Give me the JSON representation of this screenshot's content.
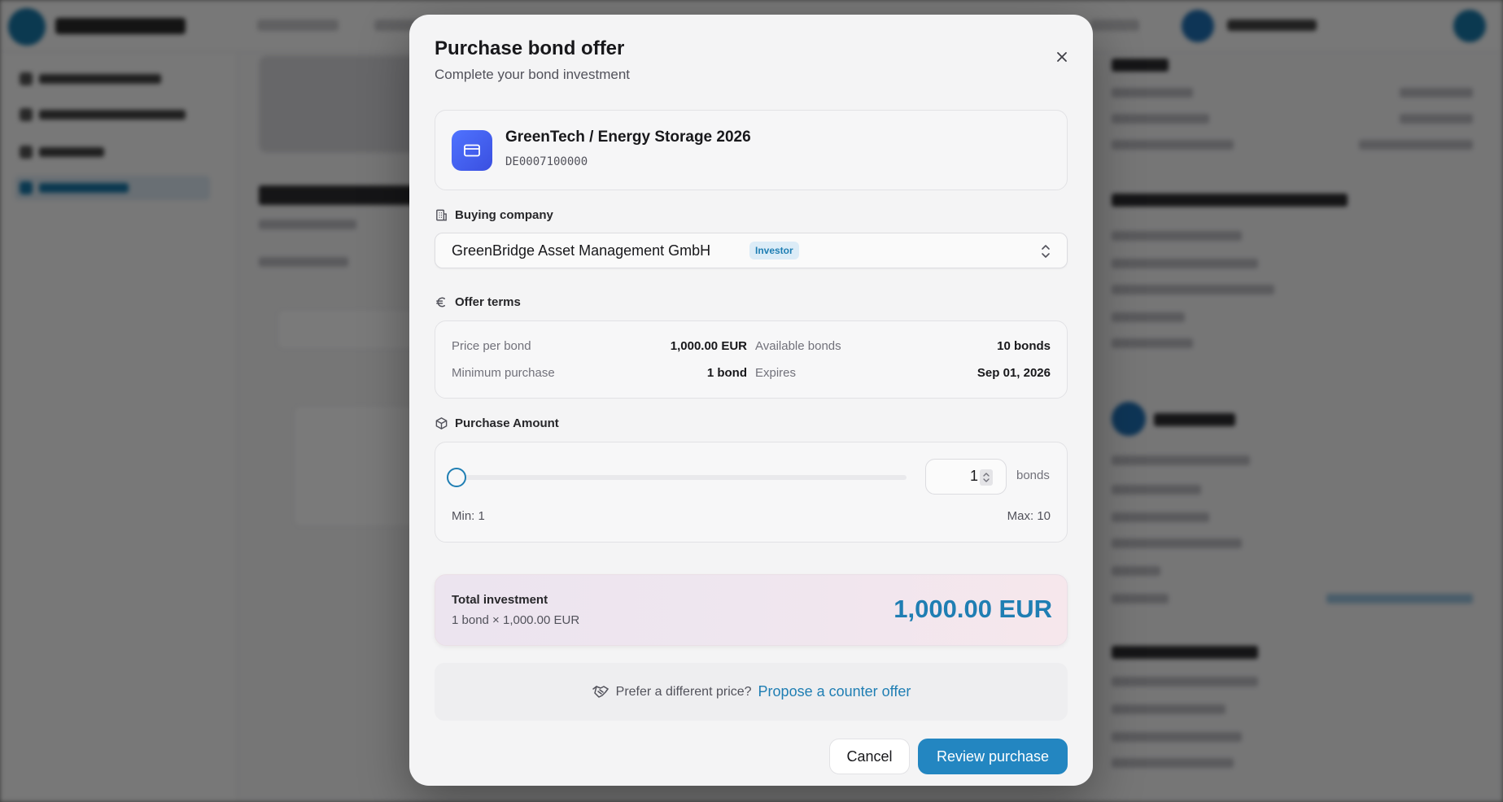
{
  "modal": {
    "title": "Purchase bond offer",
    "subtitle": "Complete your bond investment"
  },
  "bond": {
    "name": "GreenTech / Energy Storage 2026",
    "isin": "DE0007100000"
  },
  "buying_company": {
    "label": "Buying company",
    "selected": "GreenBridge Asset Management GmbH",
    "badge": "Investor"
  },
  "offer_terms": {
    "label": "Offer terms",
    "price_label": "Price per bond",
    "price_value": "1,000.00 EUR",
    "available_label": "Available bonds",
    "available_value": "10 bonds",
    "min_label": "Minimum purchase",
    "min_value": "1 bond",
    "expires_label": "Expires",
    "expires_value": "Sep 01, 2026"
  },
  "purchase_amount": {
    "label": "Purchase Amount",
    "quantity": "1",
    "unit": "bonds",
    "min_text": "Min: 1",
    "max_text": "Max: 10",
    "slider_fraction": 0
  },
  "total": {
    "label": "Total investment",
    "breakdown": "1 bond × 1,000.00 EUR",
    "amount": "1,000.00 EUR"
  },
  "counter_offer": {
    "prompt": "Prefer a different price?",
    "link": "Propose a counter offer"
  },
  "actions": {
    "cancel": "Cancel",
    "review": "Review purchase"
  },
  "colors": {
    "accent": "#1f7eb3",
    "primary_button": "#2386c1",
    "bond_icon": "#4f73ff"
  }
}
